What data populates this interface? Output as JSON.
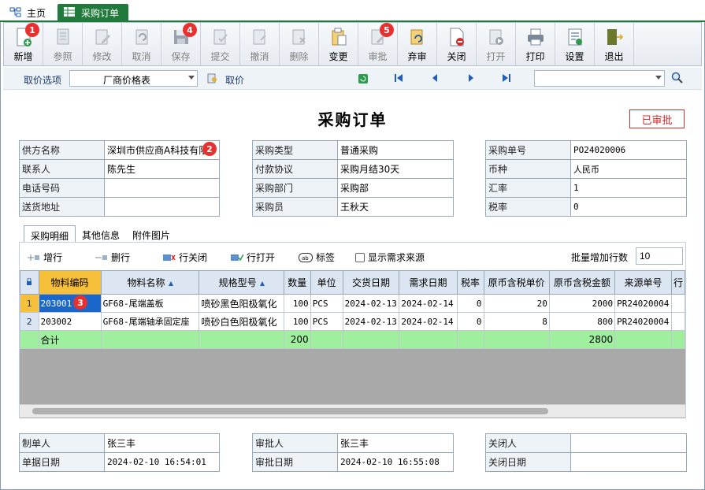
{
  "tabs": {
    "home": "主页",
    "active": "采购订单"
  },
  "toolbar": [
    {
      "label": "新增",
      "icon": "add-doc-icon",
      "enabled": true,
      "badge": "1"
    },
    {
      "label": "参照",
      "icon": "reference-icon",
      "enabled": false,
      "badge": ""
    },
    {
      "label": "修改",
      "icon": "edit-icon",
      "enabled": false,
      "badge": ""
    },
    {
      "label": "取消",
      "icon": "undo-icon",
      "enabled": false,
      "badge": ""
    },
    {
      "label": "保存",
      "icon": "save-icon",
      "enabled": false,
      "badge": "4"
    },
    {
      "label": "提交",
      "icon": "submit-icon",
      "enabled": false,
      "badge": ""
    },
    {
      "label": "撤消",
      "icon": "revoke-icon",
      "enabled": false,
      "badge": ""
    },
    {
      "label": "删除",
      "icon": "delete-icon",
      "enabled": false,
      "badge": ""
    },
    {
      "label": "变更",
      "icon": "change-icon",
      "enabled": true,
      "badge": ""
    },
    {
      "label": "审批",
      "icon": "approve-icon",
      "enabled": false,
      "badge": "5"
    },
    {
      "label": "弃审",
      "icon": "unapprove-icon",
      "enabled": true,
      "badge": ""
    },
    {
      "label": "关闭",
      "icon": "close-doc-icon",
      "enabled": true,
      "badge": ""
    },
    {
      "label": "打开",
      "icon": "open-doc-icon",
      "enabled": false,
      "badge": ""
    },
    {
      "label": "打印",
      "icon": "printer-icon",
      "enabled": true,
      "badge": ""
    },
    {
      "label": "设置",
      "icon": "settings-icon",
      "enabled": true,
      "badge": ""
    },
    {
      "label": "退出",
      "icon": "exit-icon",
      "enabled": true,
      "badge": ""
    }
  ],
  "pricebar": {
    "option_label": "取价选项",
    "option_value": "厂商价格表",
    "fetch_label": "取价",
    "search_value": ""
  },
  "document": {
    "title": "采购订单",
    "status": "已审批"
  },
  "header_left": [
    {
      "key": "供方名称",
      "value": "深圳市供应商A科技有限"
    },
    {
      "key": "联系人",
      "value": "陈先生"
    },
    {
      "key": "电话号码",
      "value": ""
    },
    {
      "key": "送货地址",
      "value": ""
    }
  ],
  "header_mid": [
    {
      "key": "采购类型",
      "value": "普通采购"
    },
    {
      "key": "付款协议",
      "value": "采购月结30天"
    },
    {
      "key": "采购部门",
      "value": "采购部"
    },
    {
      "key": "采购员",
      "value": "王秋天"
    }
  ],
  "header_right": [
    {
      "key": "采购单号",
      "value": "PO24020006"
    },
    {
      "key": "币种",
      "value": "人民币"
    },
    {
      "key": "汇率",
      "value": "1"
    },
    {
      "key": "税率",
      "value": "0"
    }
  ],
  "detail_tabs": [
    "采购明细",
    "其他信息",
    "附件图片"
  ],
  "detail_toolbar": {
    "add_row": "增行",
    "delete_row": "删行",
    "close_row": "行关闭",
    "open_row": "行打开",
    "tag": "标签",
    "show_source": "显示需求来源",
    "batch_label": "批量增加行数",
    "batch_value": "10"
  },
  "grid": {
    "columns": [
      "物料编码",
      "物料名称",
      "规格型号",
      "数量",
      "单位",
      "交货日期",
      "需求日期",
      "税率",
      "原币含税单价",
      "原币含税金额",
      "来源单号",
      "行"
    ],
    "rows": [
      {
        "no": "1",
        "code": "203001",
        "name": "GF68-尾端盖板",
        "spec": "喷砂黑色阳极氧化",
        "qty": "100",
        "unit": "PCS",
        "delivery": "2024-02-13",
        "need": "2024-02-14",
        "tax": "0",
        "price": "20",
        "amount": "2000",
        "source": "PR24020004"
      },
      {
        "no": "2",
        "code": "203002",
        "name": "GF68-尾端轴承固定座",
        "spec": "喷砂白色阳极氧化",
        "qty": "100",
        "unit": "PCS",
        "delivery": "2024-02-13",
        "need": "2024-02-14",
        "tax": "0",
        "price": "8",
        "amount": "800",
        "source": "PR24020004"
      }
    ],
    "total": {
      "label": "合计",
      "qty": "200",
      "amount": "2800"
    }
  },
  "footer_left": [
    {
      "key": "制单人",
      "value": "张三丰"
    },
    {
      "key": "单据日期",
      "value": "2024-02-10 16:54:01"
    }
  ],
  "footer_mid": [
    {
      "key": "审批人",
      "value": "张三丰"
    },
    {
      "key": "审批日期",
      "value": "2024-02-10 16:55:08"
    }
  ],
  "footer_right": [
    {
      "key": "关闭人",
      "value": ""
    },
    {
      "key": "关闭日期",
      "value": ""
    }
  ],
  "callouts": {
    "supplier": "2",
    "code_cell": "3"
  },
  "colors": {
    "accent": "#1f7a3c",
    "badge": "#e8302f",
    "total_row": "#9fef9f",
    "selected_header": "#f7c03a",
    "status": "#d42b2b"
  }
}
